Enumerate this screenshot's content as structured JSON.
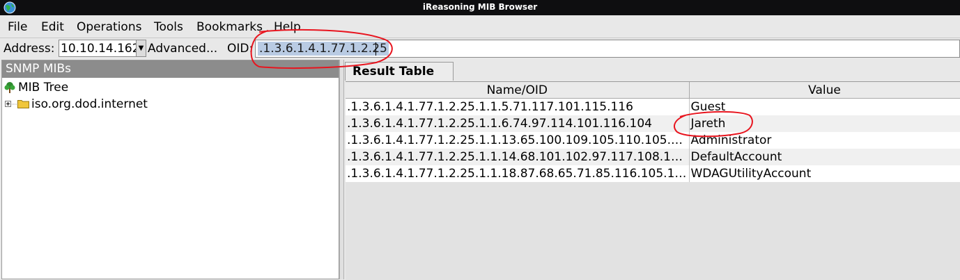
{
  "window": {
    "title": "iReasoning MIB Browser",
    "app_icon": "globe-icon"
  },
  "menu": [
    "File",
    "Edit",
    "Operations",
    "Tools",
    "Bookmarks",
    "Help"
  ],
  "address_bar": {
    "address_label": "Address:",
    "address_value": "10.10.14.162",
    "advanced_label": "Advanced...",
    "oid_label": "OID:",
    "oid_value": ".1.3.6.1.4.1.77.1.2.25"
  },
  "left_panel": {
    "header": "SNMP MIBs",
    "tree": [
      {
        "label": "MIB Tree",
        "icon": "tree-icon"
      },
      {
        "label": "iso.org.dod.internet",
        "icon": "folder-icon",
        "expander": "plus-icon"
      }
    ]
  },
  "tab": {
    "label": "Result Table"
  },
  "result_table": {
    "columns": [
      "Name/OID",
      "Value"
    ],
    "rows": [
      {
        "oid": ".1.3.6.1.4.1.77.1.2.25.1.1.5.71.117.101.115.116",
        "value": "Guest"
      },
      {
        "oid": ".1.3.6.1.4.1.77.1.2.25.1.1.6.74.97.114.101.116.104",
        "value": "Jareth"
      },
      {
        "oid": ".1.3.6.1.4.1.77.1.2.25.1.1.13.65.100.109.105.110.105.115.1...",
        "value": "Administrator"
      },
      {
        "oid": ".1.3.6.1.4.1.77.1.2.25.1.1.14.68.101.102.97.117.108.116.65...",
        "value": "DefaultAccount"
      },
      {
        "oid": ".1.3.6.1.4.1.77.1.2.25.1.1.18.87.68.65.71.85.116.105.108.1...",
        "value": "WDAGUtilityAccount"
      }
    ]
  },
  "colors": {
    "titlebar": "#0e0e10",
    "annotation": "#e8141e",
    "selection": "#b9cbe3",
    "panel_header": "#8c8c8c"
  }
}
